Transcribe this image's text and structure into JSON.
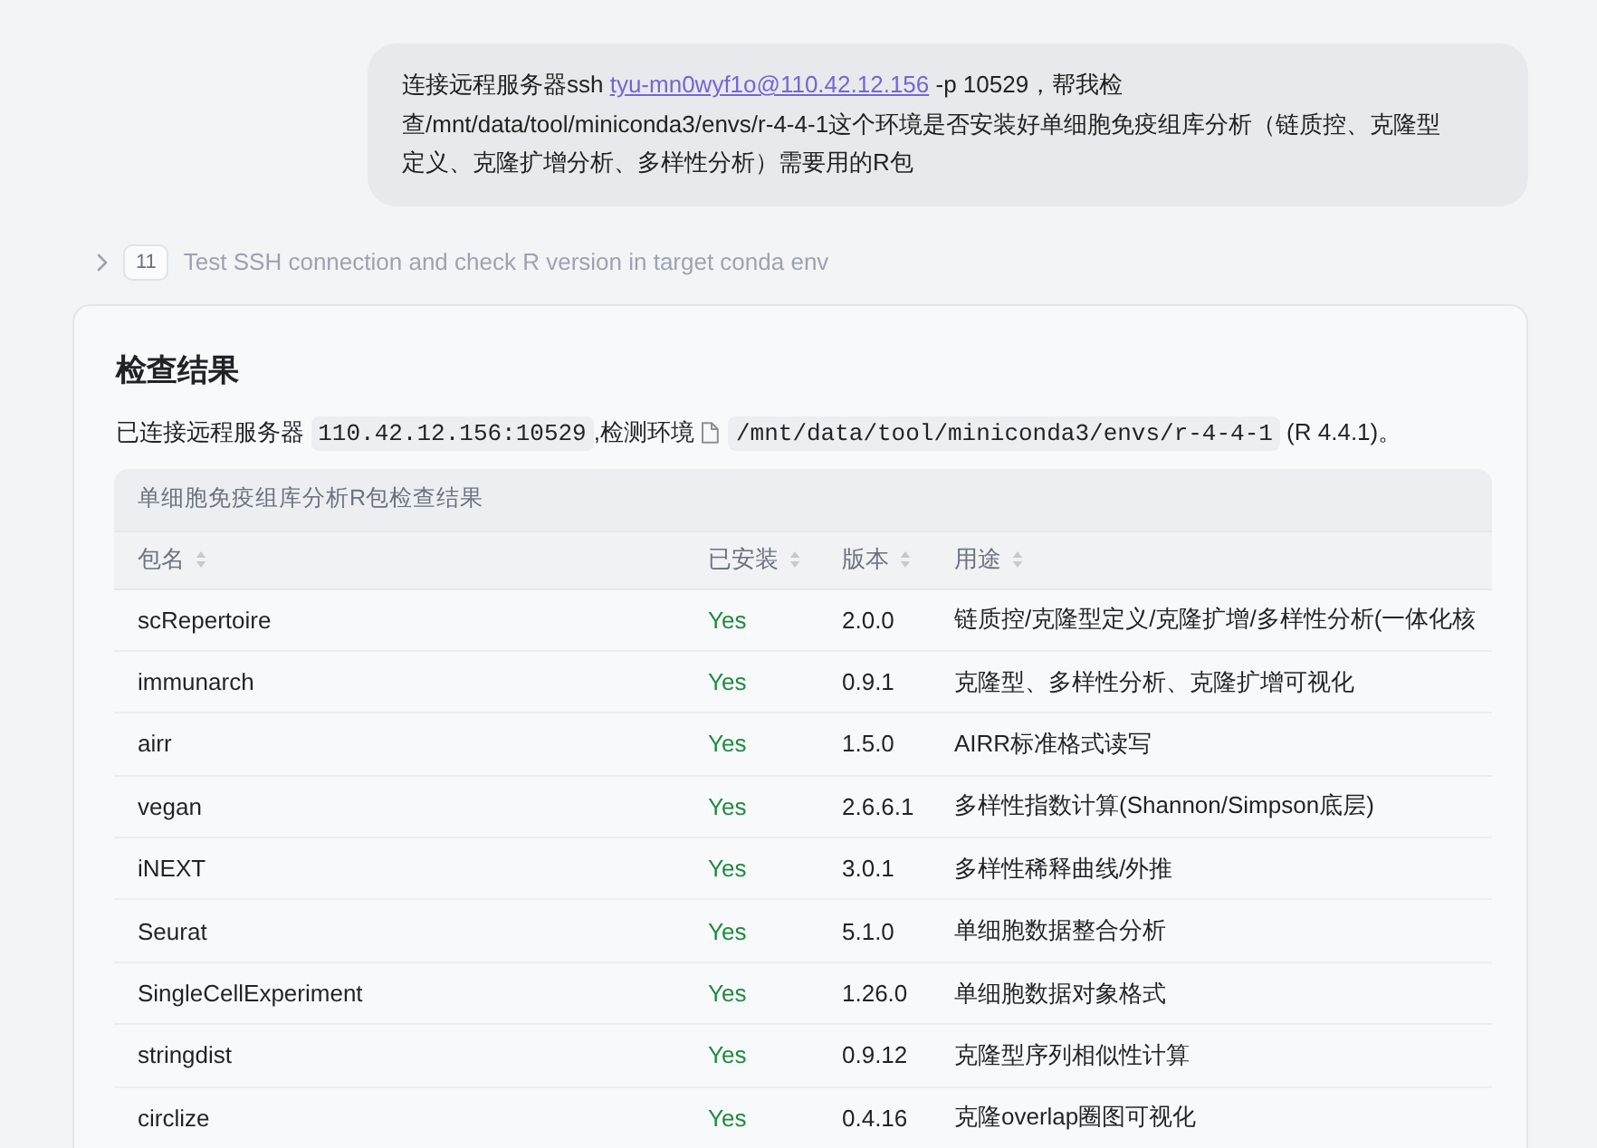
{
  "user_message": {
    "parts": [
      {
        "kind": "text",
        "text": "连接远程服务器ssh "
      },
      {
        "kind": "link",
        "text": "tyu-mn0wyf1o@110.42.12.156"
      },
      {
        "kind": "text",
        "text": " -p 10529，帮我检查/mnt/data/tool/miniconda3/envs/r-4-4-1这个环境是否安装好单细胞免疫组库分析（链质控、克隆型定义、克隆扩增分析、多样性分析）需要用的R包"
      }
    ]
  },
  "step": {
    "expanded": false,
    "number": "11",
    "title": "Test SSH connection and check R version in target conda env"
  },
  "result": {
    "title": "检查结果",
    "summary": [
      {
        "kind": "text",
        "text": "已连接远程服务器 "
      },
      {
        "kind": "code",
        "text": "110.42.12.156:10529"
      },
      {
        "kind": "text",
        "text": ",检测环境"
      },
      {
        "kind": "file",
        "text": "/mnt/data/tool/miniconda3/envs/r-4-4-1"
      },
      {
        "kind": "text",
        "text": " (R 4.4.1)。"
      }
    ],
    "table": {
      "caption": "单细胞免疫组库分析R包检查结果",
      "columns": [
        {
          "label": "包名",
          "kind": "text"
        },
        {
          "label": "已安装",
          "kind": "status"
        },
        {
          "label": "版本",
          "kind": "text"
        },
        {
          "label": "用途",
          "kind": "text"
        }
      ],
      "rows": [
        [
          "scRepertoire",
          "Yes",
          "2.0.0",
          "链质控/克隆型定义/克隆扩增/多样性分析(一体化核"
        ],
        [
          "immunarch",
          "Yes",
          "0.9.1",
          "克隆型、多样性分析、克隆扩增可视化"
        ],
        [
          "airr",
          "Yes",
          "1.5.0",
          "AIRR标准格式读写"
        ],
        [
          "vegan",
          "Yes",
          "2.6.6.1",
          "多样性指数计算(Shannon/Simpson底层)"
        ],
        [
          "iNEXT",
          "Yes",
          "3.0.1",
          "多样性稀释曲线/外推"
        ],
        [
          "Seurat",
          "Yes",
          "5.1.0",
          "单细胞数据整合分析"
        ],
        [
          "SingleCellExperiment",
          "Yes",
          "1.26.0",
          "单细胞数据对象格式"
        ],
        [
          "stringdist",
          "Yes",
          "0.9.12",
          "克隆型序列相似性计算"
        ],
        [
          "circlize",
          "Yes",
          "0.4.16",
          "克隆overlap圈图可视化"
        ]
      ]
    }
  }
}
